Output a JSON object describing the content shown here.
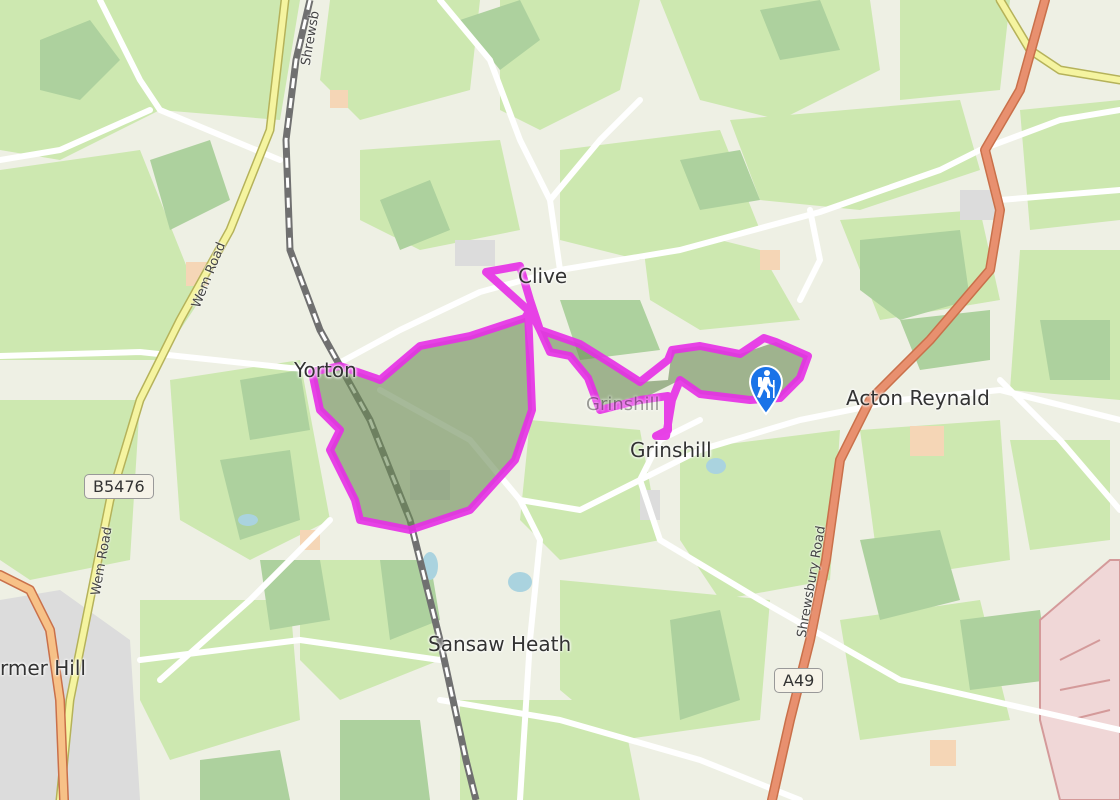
{
  "places": {
    "clive": "Clive",
    "yorton": "Yorton",
    "grinshill": "Grinshill",
    "grinshill_hill": "Grinshill",
    "acton_reynald": "Acton Reynald",
    "sansaw_heath": "Sansaw Heath",
    "harmer_hill": "rmer Hill"
  },
  "roads": {
    "b5476": "B5476",
    "a49": "A49",
    "wem_road_upper": "Wem Road",
    "wem_road_lower": "Wem Road",
    "shrewsbury_road": "Shrewsbury Road",
    "rail_label": "Shrewsb"
  },
  "map": {
    "route_color": "#e62ee6",
    "land_color": "#eef0e4",
    "field_color": "#cde8b0",
    "wood_color": "#add19e",
    "major_road_color": "#e8906f",
    "secondary_road_color": "#f5f4a0",
    "rail_color": "#707070",
    "marker_color": "#1a73e8",
    "marker_icon": "hiker-icon",
    "route_fill_color": "#6b8a55"
  }
}
